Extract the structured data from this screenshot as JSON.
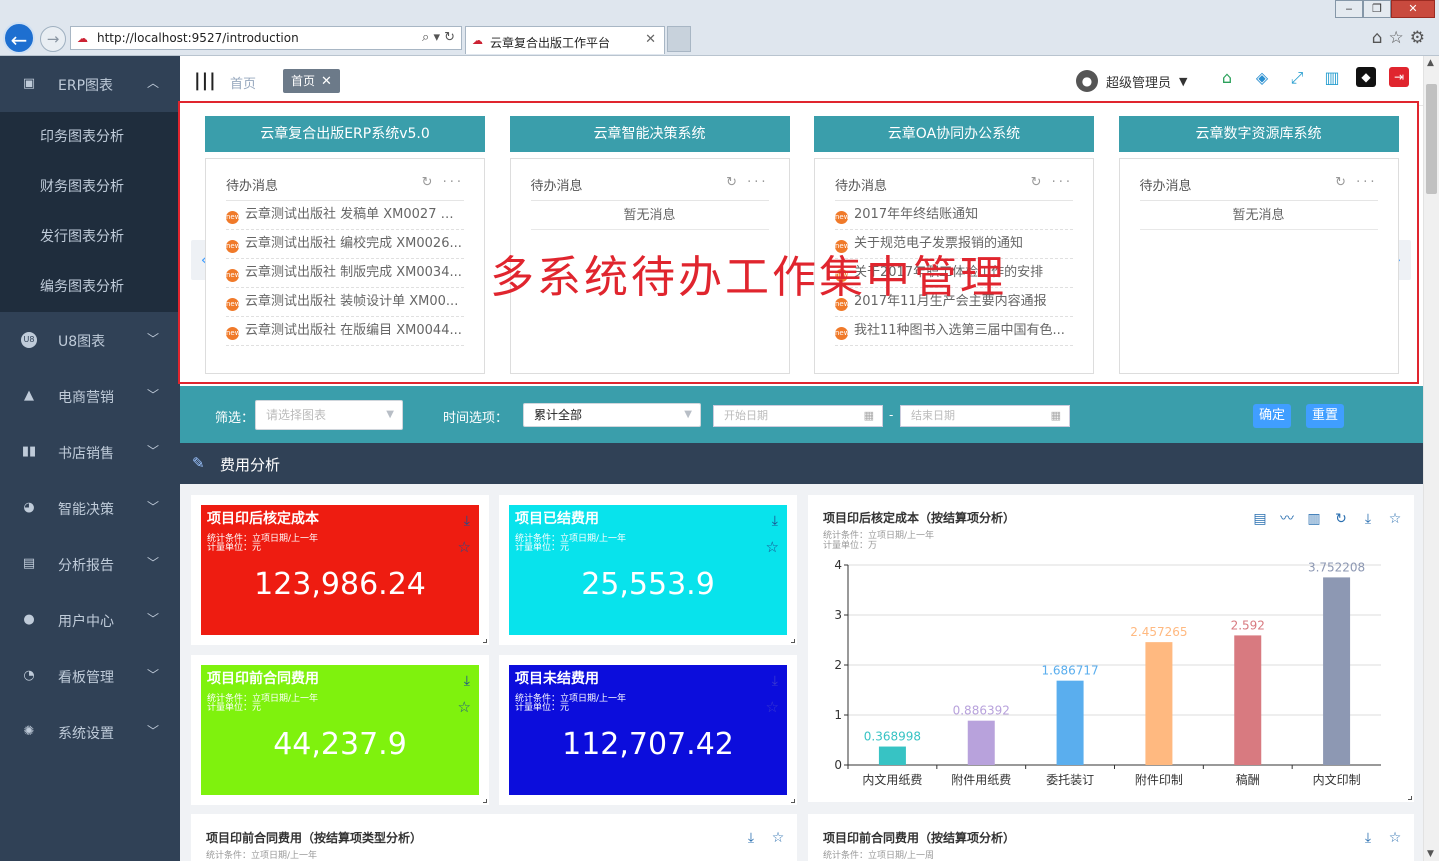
{
  "browser": {
    "url": "http://localhost:9527/introduction",
    "tab_title": "云章复合出版工作平台",
    "back_icon": "arrow-left-icon",
    "forward_icon": "arrow-right-icon"
  },
  "sidebar": {
    "bg_color": "#304156",
    "groups": [
      {
        "label": "ERP图表",
        "icon": "chart-icon",
        "expanded": true,
        "children": [
          "印务图表分析",
          "财务图表分析",
          "发行图表分析",
          "编务图表分析"
        ]
      },
      {
        "label": "U8图表",
        "icon": "u8-icon"
      },
      {
        "label": "电商营销",
        "icon": "bag-icon"
      },
      {
        "label": "书店销售",
        "icon": "book-icon"
      },
      {
        "label": "智能决策",
        "icon": "brain-icon"
      },
      {
        "label": "分析报告",
        "icon": "report-icon"
      },
      {
        "label": "用户中心",
        "icon": "user-icon"
      },
      {
        "label": "看板管理",
        "icon": "dashboard-icon"
      },
      {
        "label": "系统设置",
        "icon": "settings-icon"
      }
    ]
  },
  "navbar": {
    "home_crumb": "首页",
    "active_tag": "首页",
    "user_name": "超级管理员",
    "icons": [
      "home-icon",
      "layers-icon",
      "fullscreen-icon",
      "bar-chart-icon",
      "shirt-icon",
      "logout-icon"
    ]
  },
  "carousel": {
    "overlay_text": "多系统待办工作集中管理",
    "systems": [
      {
        "name": "云章复合出版ERP系统v5.0",
        "todo_title": "待办消息",
        "empty": "",
        "items": [
          "云章测试出版社 发稿单 XM0027 待...",
          "云章测试出版社 编校完成 XM0026...",
          "云章测试出版社 制版完成 XM0034...",
          "云章测试出版社 装帧设计单 XM00...",
          "云章测试出版社 在版编目 XM0044..."
        ]
      },
      {
        "name": "云章智能决策系统",
        "todo_title": "待办消息",
        "empty": "暂无消息",
        "items": []
      },
      {
        "name": "云章OA协同办公系统",
        "todo_title": "待办消息",
        "empty": "",
        "items": [
          "2017年年终结账通知",
          "关于规范电子发票报销的通知",
          "关于2017年职工体检工作的安排",
          "2017年11月生产会主要内容通报",
          "我社11种图书入选第三届中国有色..."
        ]
      },
      {
        "name": "云章数字资源库系统",
        "todo_title": "待办消息",
        "empty": "暂无消息",
        "items": []
      }
    ]
  },
  "filter": {
    "filter_label": "筛选：",
    "chart_placeholder": "请选择图表",
    "time_label": "时间选项：",
    "time_value": "累计全部",
    "start_placeholder": "开始日期",
    "end_placeholder": "结束日期",
    "separator": "-",
    "confirm": "确定",
    "reset": "重置"
  },
  "section": {
    "title": "费用分析"
  },
  "stats": [
    {
      "title": "项目印后核定成本",
      "cond1": "统计条件：立项日期/上一年",
      "cond2": "计量单位：元",
      "value": "123,986.24",
      "color": "#ee1c11"
    },
    {
      "title": "项目已结费用",
      "cond1": "统计条件：立项日期/上一年",
      "cond2": "计量单位：元",
      "value": "25,553.9",
      "color": "#08e3ec"
    },
    {
      "title": "项目印前合同费用",
      "cond1": "统计条件：立项日期/上一年",
      "cond2": "计量单位：元",
      "value": "44,237.9",
      "color": "#7ff20d"
    },
    {
      "title": "项目未结费用",
      "cond1": "统计条件：立项日期/上一年",
      "cond2": "计量单位：元",
      "value": "112,707.42",
      "color": "#0c0ddc"
    }
  ],
  "chart_card": {
    "title": "项目印后核定成本（按结算项分析）",
    "cond1": "统计条件：立项日期/上一年",
    "cond2": "计量单位：万"
  },
  "chart_data": {
    "type": "bar",
    "categories": [
      "内文用纸费",
      "附件用纸费",
      "委托装订",
      "附件印制",
      "稿酬",
      "内文印制"
    ],
    "values": [
      0.368998,
      0.886392,
      1.686717,
      2.457265,
      2.592,
      3.752208
    ],
    "colors": [
      "#37c3c4",
      "#b8a2dc",
      "#5aaeee",
      "#ffb980",
      "#d87a80",
      "#8d98b3"
    ],
    "ylim": [
      0,
      4
    ],
    "yticks": [
      0,
      1,
      2,
      3,
      4
    ],
    "grid": true
  },
  "bottom_cards": [
    {
      "title": "项目印前合同费用（按结算项类型分析）",
      "cond1": "统计条件：立项日期/上一年"
    },
    {
      "title": "项目印前合同费用（按结算项分析）",
      "cond1": "统计条件：立项日期/上一周"
    }
  ]
}
